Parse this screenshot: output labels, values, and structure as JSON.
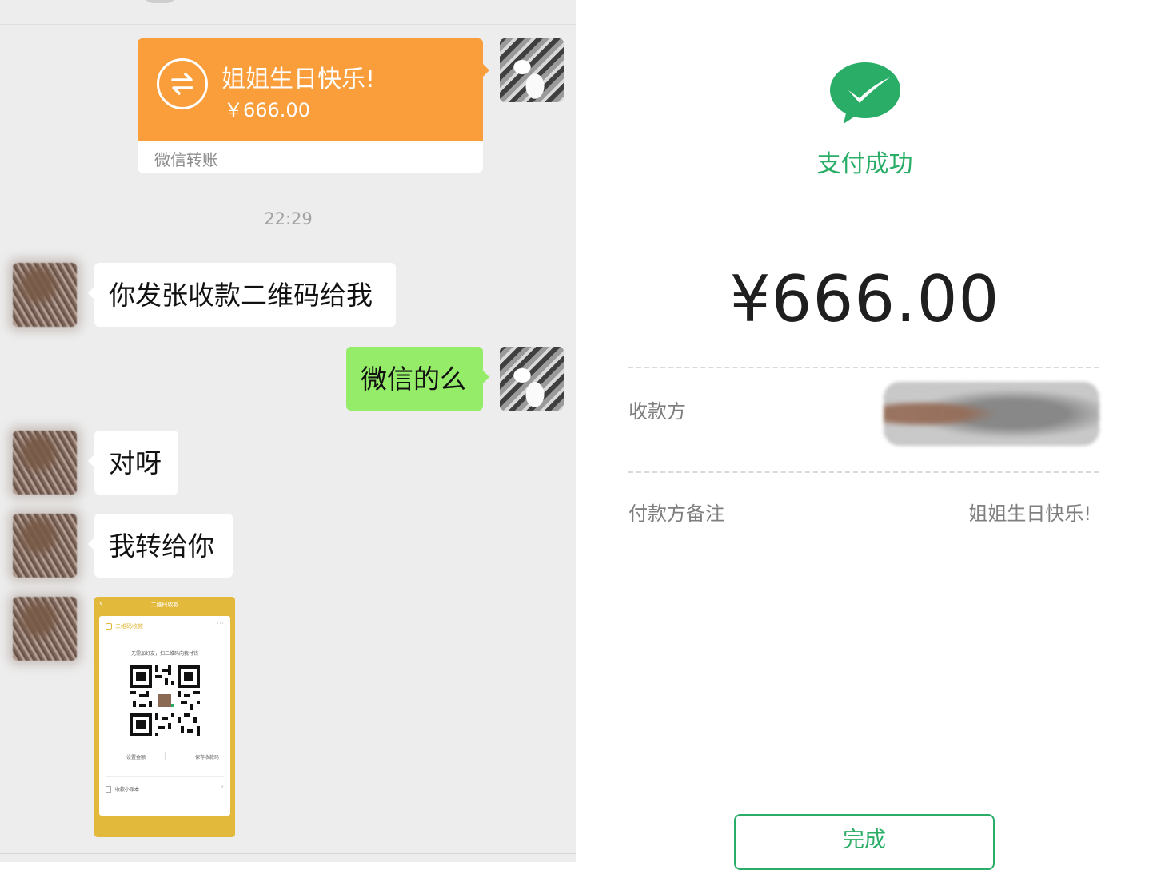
{
  "chat": {
    "transfer": {
      "title": "姐姐生日快乐!",
      "amount": "￥666.00",
      "footer": "微信转账"
    },
    "timestamp": "22:29",
    "messages": [
      {
        "from": "other",
        "text": "你发张收款二维码给我"
      },
      {
        "from": "self",
        "text": "微信的么"
      },
      {
        "from": "other",
        "text": "对呀"
      },
      {
        "from": "other",
        "text": "我转给你"
      }
    ],
    "qr_screenshot": {
      "header": "二维码收款",
      "tab": "二维码收款",
      "hint": "无需加好友，扫二维码向我付钱",
      "set_amount": "设置金额",
      "save_code": "保存收款码",
      "ledger": "收款小账本"
    }
  },
  "payment": {
    "status": "支付成功",
    "amount": "¥666.00",
    "payee_label": "收款方",
    "remark_label": "付款方备注",
    "remark_value": "姐姐生日快乐!",
    "done_button": "完成"
  },
  "colors": {
    "wechat_green": "#2aae67",
    "bubble_green": "#95ec69",
    "transfer_orange": "#fa9d3b",
    "qr_yellow": "#e2b93b",
    "chat_bg": "#ededed"
  },
  "icons": {
    "transfer": "transfer-arrows-icon",
    "logo": "wechat-pay-check-icon"
  }
}
